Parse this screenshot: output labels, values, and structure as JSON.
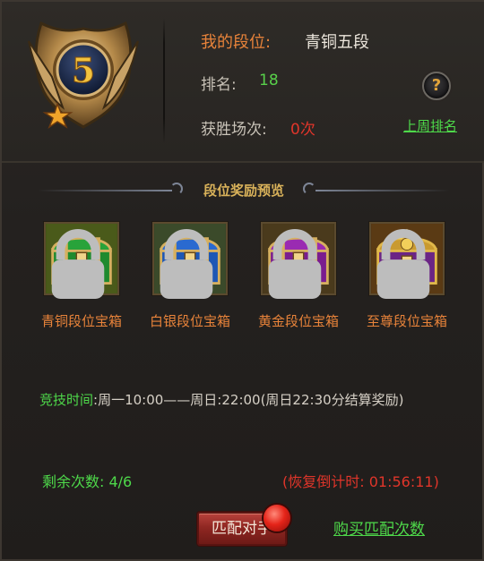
{
  "badge": {
    "level": "5"
  },
  "my_rank": {
    "label": "我的段位:",
    "value": "青铜五段"
  },
  "ranking": {
    "label": "排名:",
    "value": "18"
  },
  "wins": {
    "label": "获胜场次:",
    "value": "0次"
  },
  "help": {
    "glyph": "?"
  },
  "last_week_link": "上周排名",
  "rewards": {
    "title": "段位奖励预览",
    "chests": [
      {
        "label": "青铜段位宝箱",
        "color": "#1f8a2e"
      },
      {
        "label": "白银段位宝箱",
        "color": "#1d57b5"
      },
      {
        "label": "黄金段位宝箱",
        "color": "#7a1d8f"
      },
      {
        "label": "至尊段位宝箱",
        "color": "#6b2585"
      }
    ]
  },
  "schedule": {
    "label": "竞技时间",
    "value": ":周一10:00——周日:22:00(周日22:30分结算奖励)"
  },
  "remaining": "剩余次数: 4/6",
  "recover": "(恢复倒计时: 01:56:11)",
  "match_button": "匹配对手",
  "buy_link": "购买匹配次数"
}
